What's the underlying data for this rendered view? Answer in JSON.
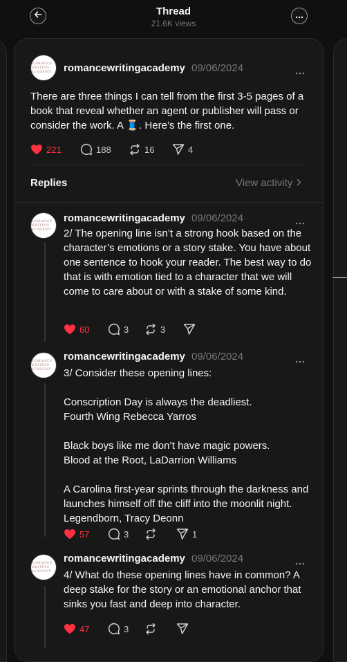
{
  "header": {
    "title": "Thread",
    "views": "21.6K views"
  },
  "main_post": {
    "username": "romancewritingacademy",
    "date": "09/06/2024",
    "text": "There are three things I can tell from the first 3-5 pages of a book that reveal whether an agent or publisher will pass or consider the work. A 🧵. Here’s the first one.",
    "likes": "221",
    "comments": "188",
    "reposts": "16",
    "shares": "4"
  },
  "replies_header": {
    "label": "Replies",
    "view_activity": "View activity"
  },
  "replies": [
    {
      "username": "romancewritingacademy",
      "date": "09/06/2024",
      "text": "2/ The opening line isn’t a strong hook based on the character’s emotions or a story stake. You have about one sentence to hook your reader. The best way to do that is with emotion tied to a character that we will come to care about or with a stake of some kind.",
      "likes": "60",
      "comments": "3",
      "reposts": "3",
      "shares": ""
    },
    {
      "username": "romancewritingacademy",
      "date": "09/06/2024",
      "text": "3/ Consider these opening lines:\n\nConscription Day is always the deadliest.\nFourth Wing Rebecca Yarros\n\nBlack boys like me don’t have magic powers.\nBlood at the Root, LaDarrion Williams\n\nA Carolina first-year sprints through the darkness and launches himself off the cliff into the moonlit night.\nLegendborn, Tracy Deonn",
      "likes": "57",
      "comments": "3",
      "reposts": "",
      "shares": "1"
    },
    {
      "username": "romancewritingacademy",
      "date": "09/06/2024",
      "text": "4/ What do these opening lines have in common? A deep stake for the story or an emotional anchor that sinks you fast and deep into character.",
      "likes": "47",
      "comments": "3",
      "reposts": "",
      "shares": ""
    }
  ],
  "avatar": {
    "logo_text": "ROMANCE WRITING ACADEMY"
  },
  "colors": {
    "background": "#101010",
    "panel": "#181818",
    "like_red": "#ff3040",
    "muted": "#777777"
  },
  "icons": [
    "back-arrow-icon",
    "more-icon",
    "heart-icon",
    "comment-icon",
    "repost-icon",
    "share-icon",
    "chevron-right-icon"
  ]
}
